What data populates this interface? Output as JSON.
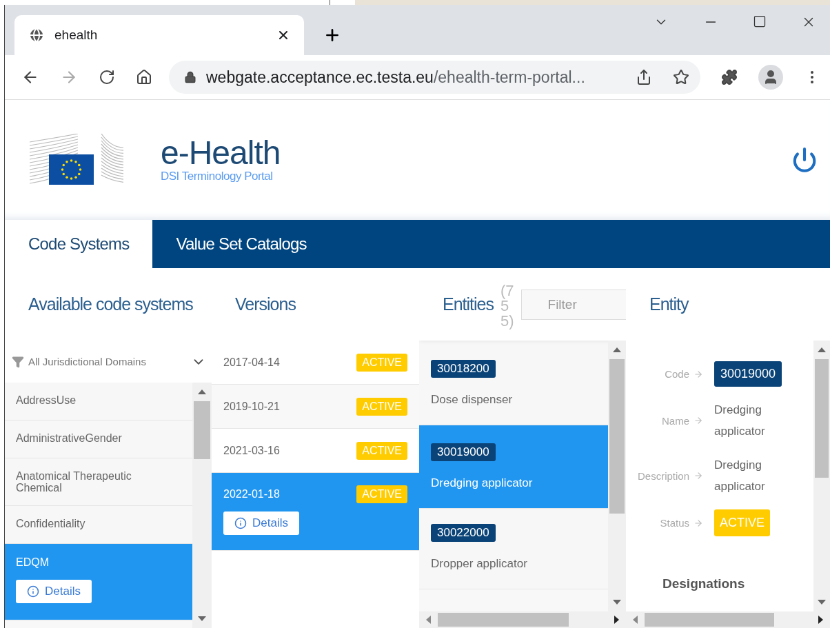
{
  "browser": {
    "tab_title": "ehealth",
    "url_host": "webgate.acceptance.ec.testa.eu",
    "url_path": "/ehealth-term-portal..."
  },
  "header": {
    "title": "e-Health",
    "subtitle": "DSI Terminology Portal"
  },
  "nav": [
    {
      "label": "Code Systems",
      "selected": true
    },
    {
      "label": "Value Set Catalogs",
      "selected": false
    }
  ],
  "code_systems": {
    "title": "Available code systems",
    "filter": "All Jurisdictional Domains",
    "details_button": "Details",
    "items": [
      {
        "name": "AddressUse",
        "selected": false
      },
      {
        "name": "AdministrativeGender",
        "selected": false
      },
      {
        "name": "Anatomical Therapeutic Chemical",
        "selected": false
      },
      {
        "name": "Confidentiality",
        "selected": false
      },
      {
        "name": "EDQM",
        "selected": true
      }
    ]
  },
  "versions": {
    "title": "Versions",
    "details_button": "Details",
    "items": [
      {
        "date": "2017-04-14",
        "status": "ACTIVE",
        "selected": false
      },
      {
        "date": "2019-10-21",
        "status": "ACTIVE",
        "selected": false
      },
      {
        "date": "2021-03-16",
        "status": "ACTIVE",
        "selected": false
      },
      {
        "date": "2022-01-18",
        "status": "ACTIVE",
        "selected": true
      }
    ]
  },
  "entities": {
    "title": "Entities",
    "count": "(755)",
    "filter_placeholder": "Filter",
    "items": [
      {
        "code": "30018200",
        "name": "Dose dispenser",
        "selected": false
      },
      {
        "code": "30019000",
        "name": "Dredging applicator",
        "selected": true
      },
      {
        "code": "30022000",
        "name": "Dropper applicator",
        "selected": false
      }
    ]
  },
  "entity": {
    "title": "Entity",
    "fields": [
      {
        "kind": "code",
        "label": "Code",
        "value": "30019000"
      },
      {
        "kind": "text",
        "label": "Name",
        "value": "Dredging applicator"
      },
      {
        "kind": "text",
        "label": "Description",
        "value": "Dredging applicator"
      },
      {
        "kind": "status",
        "label": "Status",
        "value": "ACTIVE"
      }
    ],
    "section": "Designations"
  }
}
